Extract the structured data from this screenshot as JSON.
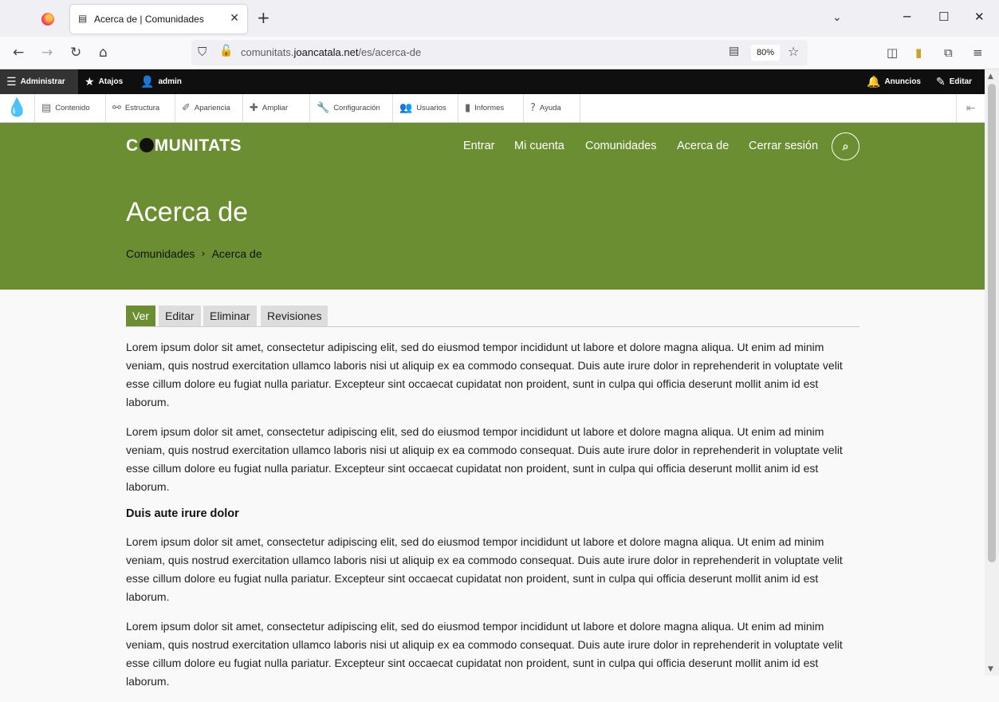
{
  "browser": {
    "tab_title": "Acerca de | Comunidades",
    "url_prefix": "comunitats.",
    "url_domain": "joancatala.net",
    "url_path": "/es/acerca-de",
    "zoom": "80%"
  },
  "admin_toolbar": {
    "administrar": "Administrar",
    "atajos": "Atajos",
    "user": "admin",
    "anuncios": "Anuncios",
    "editar": "Editar",
    "tray": [
      "Contenido",
      "Estructura",
      "Apariencia",
      "Ampliar",
      "Configuración",
      "Usuarios",
      "Informes",
      "Ayuda"
    ]
  },
  "site": {
    "logo_pre": "C",
    "logo_post": "MUNITATS",
    "nav": [
      "Entrar",
      "Mi cuenta",
      "Comunidades",
      "Acerca de",
      "Cerrar sesión"
    ],
    "page_title": "Acerca de",
    "breadcrumb": [
      "Comunidades",
      "Acerca de"
    ],
    "brand_color": "#6b8e33"
  },
  "content_tabs": [
    "Ver",
    "Editar",
    "Eliminar",
    "Revisiones"
  ],
  "content": {
    "p1": "Lorem ipsum dolor sit amet, consectetur adipiscing elit, sed do eiusmod tempor incididunt ut labore et dolore magna aliqua. Ut enim ad minim veniam, quis nostrud exercitation ullamco laboris nisi ut aliquip ex ea commodo consequat. Duis aute irure dolor in reprehenderit in voluptate velit esse cillum dolore eu fugiat nulla pariatur. Excepteur sint occaecat cupidatat non proident, sunt in culpa qui officia deserunt mollit anim id est laborum.",
    "p2": "Lorem ipsum dolor sit amet, consectetur adipiscing elit, sed do eiusmod tempor incididunt ut labore et dolore magna aliqua. Ut enim ad minim veniam, quis nostrud exercitation ullamco laboris nisi ut aliquip ex ea commodo consequat. Duis aute irure dolor in reprehenderit in voluptate velit esse cillum dolore eu fugiat nulla pariatur. Excepteur sint occaecat cupidatat non proident, sunt in culpa qui officia deserunt mollit anim id est laborum.",
    "heading": "Duis aute irure dolor",
    "p3": "Lorem ipsum dolor sit amet, consectetur adipiscing elit, sed do eiusmod tempor incididunt ut labore et dolore magna aliqua. Ut enim ad minim veniam, quis nostrud exercitation ullamco laboris nisi ut aliquip ex ea commodo consequat. Duis aute irure dolor in reprehenderit in voluptate velit esse cillum dolore eu fugiat nulla pariatur. Excepteur sint occaecat cupidatat non proident, sunt in culpa qui officia deserunt mollit anim id est laborum.",
    "p4": "Lorem ipsum dolor sit amet, consectetur adipiscing elit, sed do eiusmod tempor incididunt ut labore et dolore magna aliqua. Ut enim ad minim veniam, quis nostrud exercitation ullamco laboris nisi ut aliquip ex ea commodo consequat. Duis aute irure dolor in reprehenderit in voluptate velit esse cillum dolore eu fugiat nulla pariatur. Excepteur sint occaecat cupidatat non proident, sunt in culpa qui officia deserunt mollit anim id est laborum."
  }
}
